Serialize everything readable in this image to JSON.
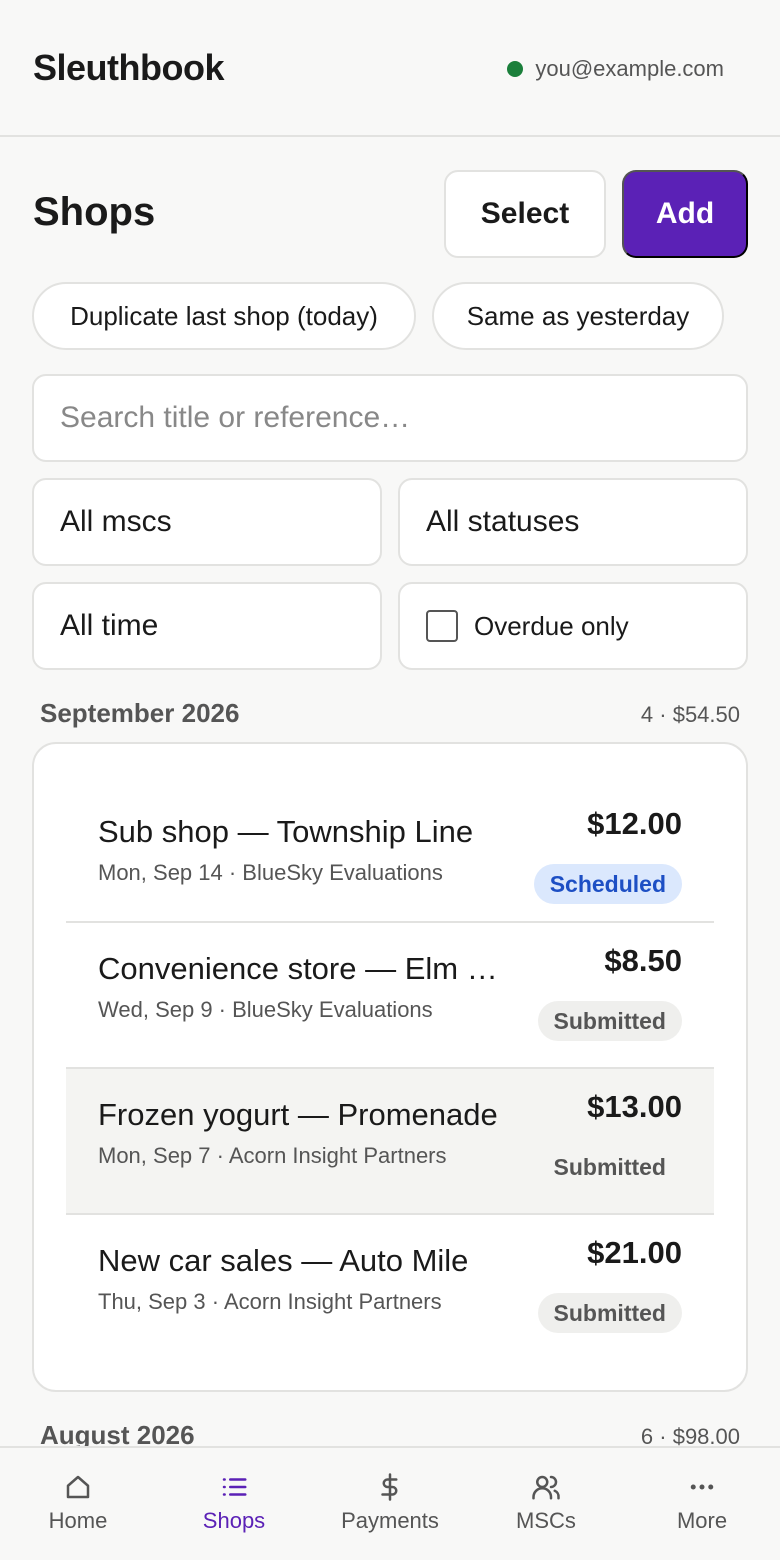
{
  "app": {
    "name": "Sleuthbook",
    "account_email": "you@example.com",
    "status_color": "#1b7f3b"
  },
  "page": {
    "title": "Shops",
    "select_label": "Select",
    "add_label": "Add",
    "accent_color": "#5b21b6"
  },
  "quick_actions": [
    {
      "label": "Duplicate last shop (today)"
    },
    {
      "label": "Same as yesterday"
    }
  ],
  "search": {
    "placeholder": "Search title or reference…"
  },
  "filters": {
    "mscs": "All mscs",
    "statuses": "All statuses",
    "time": "All time",
    "overdue_label": "Overdue only",
    "overdue_checked": false
  },
  "groups": [
    {
      "month": "September 2026",
      "summary": "4 · $54.50",
      "shops": [
        {
          "title": "Sub shop — Township Line",
          "meta": "Mon, Sep 14 · BlueSky Evaluations",
          "amount": "$12.00",
          "status": "Scheduled"
        },
        {
          "title": "Convenience store — Elm Street",
          "meta": "Wed, Sep 9 · BlueSky Evaluations",
          "amount": "$8.50",
          "status": "Submitted"
        },
        {
          "title": "Frozen yogurt — Promenade",
          "meta": "Mon, Sep 7 · Acorn Insight Partners",
          "amount": "$13.00",
          "status": "Submitted"
        },
        {
          "title": "New car sales — Auto Mile",
          "meta": "Thu, Sep 3 · Acorn Insight Partners",
          "amount": "$21.00",
          "status": "Submitted"
        }
      ]
    },
    {
      "month": "August 2026",
      "summary": "6 · $98.00"
    }
  ],
  "nav": {
    "items": [
      {
        "label": "Home",
        "icon": "home-icon"
      },
      {
        "label": "Shops",
        "icon": "list-icon",
        "active": true
      },
      {
        "label": "Payments",
        "icon": "dollar-icon"
      },
      {
        "label": "MSCs",
        "icon": "users-icon"
      },
      {
        "label": "More",
        "icon": "more-icon"
      }
    ]
  }
}
